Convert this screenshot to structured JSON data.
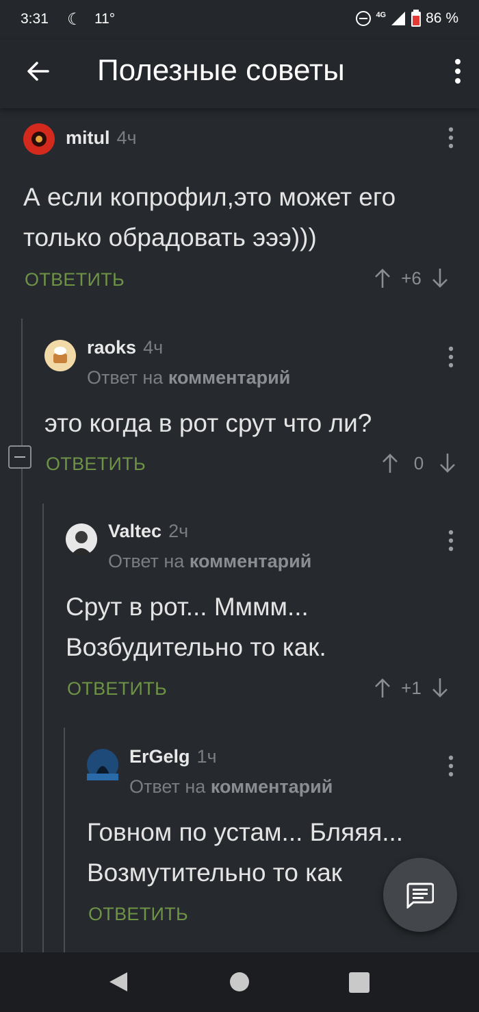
{
  "status": {
    "time": "3:31",
    "temperature": "11°",
    "battery": "86 %",
    "network": "4G"
  },
  "appbar": {
    "title": "Полезные советы",
    "back_icon": "arrow-left-icon",
    "menu_icon": "more-vertical-icon"
  },
  "comments": [
    {
      "user": "mitul",
      "time": "4ч",
      "reply_to": "",
      "lines": [
        "А если копрофил,это может его",
        "только обрадовать эээ)))"
      ],
      "reply": "ОТВЕТИТЬ",
      "score": "+6",
      "avatar_color": "#d42a1e"
    },
    {
      "user": "raoks",
      "time": "4ч",
      "reply_to_prefix": "Ответ на",
      "reply_to": "комментарий",
      "lines": [
        "это когда в рот срут что ли?"
      ],
      "reply": "ОТВЕТИТЬ",
      "score": "0",
      "avatar_color": "#f2d9a8"
    },
    {
      "user": "Valtec",
      "time": "2ч",
      "reply_to_prefix": "Ответ на",
      "reply_to": "комментарий",
      "lines": [
        "Срут в рот... Мммм...",
        "Возбудительно то как."
      ],
      "reply": "ОТВЕТИТЬ",
      "score": "+1",
      "avatar_color": "#e8e8e8"
    },
    {
      "user": "ErGelg",
      "time": "1ч",
      "reply_to_prefix": "Ответ на",
      "reply_to": "комментарий",
      "lines": [
        "Говном по устам... Бляяя...",
        "Возмутительно то как"
      ],
      "reply": "ОТВЕТИТЬ",
      "score": "",
      "avatar_color": "#1e4a7a"
    }
  ],
  "colors": {
    "background": "#262a2e",
    "accent_green": "#6e9246",
    "muted": "#7a7e82"
  },
  "fab_icon": "comment-icon"
}
